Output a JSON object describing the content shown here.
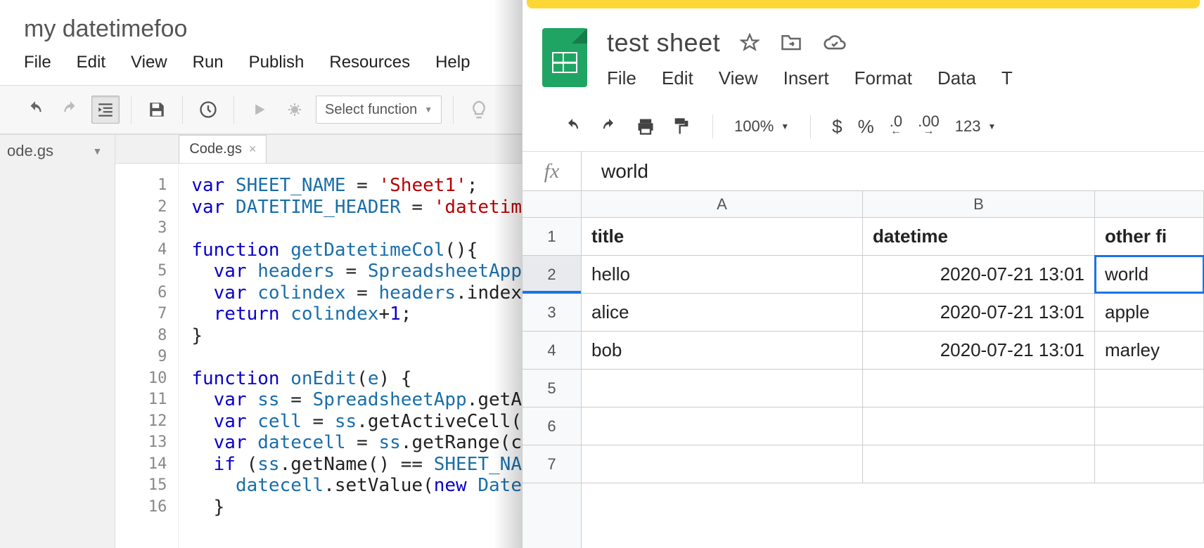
{
  "editor": {
    "title": "my datetimefoo",
    "menu": [
      "File",
      "Edit",
      "View",
      "Run",
      "Publish",
      "Resources",
      "Help"
    ],
    "select_fn_label": "Select function",
    "sidebar_file": "ode.gs",
    "tab_name": "Code.gs",
    "line_numbers": [
      "1",
      "2",
      "3",
      "4",
      "5",
      "6",
      "7",
      "8",
      "9",
      "10",
      "11",
      "12",
      "13",
      "14",
      "15",
      "16"
    ],
    "code_lines": [
      {
        "type": "var",
        "tokens": [
          {
            "t": "kw",
            "v": "var "
          },
          {
            "t": "ident",
            "v": "SHEET_NAME"
          },
          {
            "t": "plain",
            "v": " = "
          },
          {
            "t": "str",
            "v": "'Sheet1'"
          },
          {
            "t": "plain",
            "v": ";"
          }
        ]
      },
      {
        "type": "var",
        "tokens": [
          {
            "t": "kw",
            "v": "var "
          },
          {
            "t": "ident",
            "v": "DATETIME_HEADER"
          },
          {
            "t": "plain",
            "v": " = "
          },
          {
            "t": "str",
            "v": "'datetim"
          }
        ]
      },
      {
        "type": "blank",
        "tokens": []
      },
      {
        "type": "fn",
        "tokens": [
          {
            "t": "kw",
            "v": "function "
          },
          {
            "t": "ident",
            "v": "getDatetimeCol"
          },
          {
            "t": "plain",
            "v": "(){ "
          }
        ]
      },
      {
        "type": "body",
        "tokens": [
          {
            "t": "plain",
            "v": "  "
          },
          {
            "t": "kw",
            "v": "var "
          },
          {
            "t": "ident",
            "v": "headers"
          },
          {
            "t": "plain",
            "v": " = "
          },
          {
            "t": "ident",
            "v": "SpreadsheetApp"
          }
        ]
      },
      {
        "type": "body",
        "tokens": [
          {
            "t": "plain",
            "v": "  "
          },
          {
            "t": "kw",
            "v": "var "
          },
          {
            "t": "ident",
            "v": "colindex"
          },
          {
            "t": "plain",
            "v": " = "
          },
          {
            "t": "ident",
            "v": "headers"
          },
          {
            "t": "plain",
            "v": ".index"
          }
        ]
      },
      {
        "type": "body",
        "tokens": [
          {
            "t": "plain",
            "v": "  "
          },
          {
            "t": "kw",
            "v": "return "
          },
          {
            "t": "ident",
            "v": "colindex"
          },
          {
            "t": "plain",
            "v": "+"
          },
          {
            "t": "num",
            "v": "1"
          },
          {
            "t": "plain",
            "v": ";"
          }
        ]
      },
      {
        "type": "body",
        "tokens": [
          {
            "t": "plain",
            "v": "}"
          }
        ]
      },
      {
        "type": "blank",
        "tokens": []
      },
      {
        "type": "fn",
        "tokens": [
          {
            "t": "kw",
            "v": "function "
          },
          {
            "t": "ident",
            "v": "onEdit"
          },
          {
            "t": "plain",
            "v": "("
          },
          {
            "t": "ident",
            "v": "e"
          },
          {
            "t": "plain",
            "v": ") {"
          }
        ]
      },
      {
        "type": "body",
        "tokens": [
          {
            "t": "plain",
            "v": "  "
          },
          {
            "t": "kw",
            "v": "var "
          },
          {
            "t": "ident",
            "v": "ss"
          },
          {
            "t": "plain",
            "v": " = "
          },
          {
            "t": "ident",
            "v": "SpreadsheetApp"
          },
          {
            "t": "plain",
            "v": ".getA"
          }
        ]
      },
      {
        "type": "body",
        "tokens": [
          {
            "t": "plain",
            "v": "  "
          },
          {
            "t": "kw",
            "v": "var "
          },
          {
            "t": "ident",
            "v": "cell"
          },
          {
            "t": "plain",
            "v": " = "
          },
          {
            "t": "ident",
            "v": "ss"
          },
          {
            "t": "plain",
            "v": ".getActiveCell("
          }
        ]
      },
      {
        "type": "body",
        "tokens": [
          {
            "t": "plain",
            "v": "  "
          },
          {
            "t": "kw",
            "v": "var "
          },
          {
            "t": "ident",
            "v": "datecell"
          },
          {
            "t": "plain",
            "v": " = "
          },
          {
            "t": "ident",
            "v": "ss"
          },
          {
            "t": "plain",
            "v": ".getRange(c"
          }
        ]
      },
      {
        "type": "body",
        "tokens": [
          {
            "t": "plain",
            "v": "  "
          },
          {
            "t": "kw",
            "v": "if "
          },
          {
            "t": "plain",
            "v": "("
          },
          {
            "t": "ident",
            "v": "ss"
          },
          {
            "t": "plain",
            "v": ".getName() == "
          },
          {
            "t": "ident",
            "v": "SHEET_NA"
          }
        ]
      },
      {
        "type": "body",
        "tokens": [
          {
            "t": "plain",
            "v": "    "
          },
          {
            "t": "ident",
            "v": "datecell"
          },
          {
            "t": "plain",
            "v": ".setValue("
          },
          {
            "t": "kw",
            "v": "new "
          },
          {
            "t": "ident",
            "v": "Date"
          }
        ]
      },
      {
        "type": "body",
        "tokens": [
          {
            "t": "plain",
            "v": "  }"
          }
        ]
      }
    ]
  },
  "sheets": {
    "title": "test sheet",
    "menu": [
      "File",
      "Edit",
      "View",
      "Insert",
      "Format",
      "Data",
      "T"
    ],
    "zoom": "100%",
    "fmt_currency": "$",
    "fmt_percent": "%",
    "fmt_dec_dec": ".0",
    "fmt_dec_inc": ".00",
    "fmt_more": "123",
    "fx_value": "world",
    "columns": [
      "A",
      "B"
    ],
    "header_row": {
      "a": "title",
      "b": "datetime",
      "c": "other fi"
    },
    "rows": [
      {
        "n": "2",
        "a": "hello",
        "b": "2020-07-21 13:01",
        "c": "world",
        "selected": true
      },
      {
        "n": "3",
        "a": "alice",
        "b": "2020-07-21 13:01",
        "c": "apple"
      },
      {
        "n": "4",
        "a": "bob",
        "b": "2020-07-21 13:01",
        "c": "marley"
      },
      {
        "n": "5",
        "a": "",
        "b": "",
        "c": ""
      },
      {
        "n": "6",
        "a": "",
        "b": "",
        "c": ""
      },
      {
        "n": "7",
        "a": "",
        "b": "",
        "c": ""
      }
    ]
  }
}
